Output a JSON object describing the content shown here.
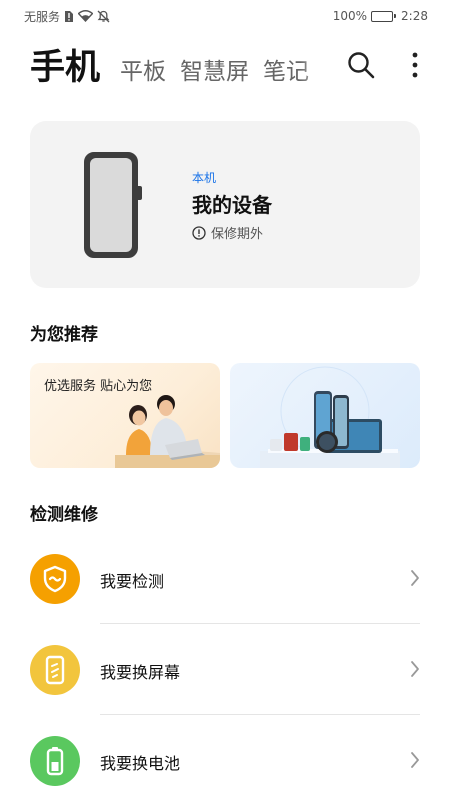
{
  "status_bar": {
    "carrier": "无服务",
    "battery": "100%",
    "time": "2:28"
  },
  "tabs": [
    {
      "label": "手机",
      "active": true
    },
    {
      "label": "平板",
      "active": false
    },
    {
      "label": "智慧屏",
      "active": false
    },
    {
      "label": "笔记",
      "active": false
    }
  ],
  "device": {
    "tag": "本机",
    "name": "我的设备",
    "warranty": "保修期外"
  },
  "recommend": {
    "title": "为您推荐",
    "cards": [
      {
        "label": "优选服务 贴心为您"
      },
      {
        "label": ""
      }
    ]
  },
  "repair": {
    "title": "检测维修",
    "items": [
      {
        "label": "我要检测",
        "icon": "shield-icon",
        "color": "#f5a000"
      },
      {
        "label": "我要换屏幕",
        "icon": "screen-icon",
        "color": "#f2c53d"
      },
      {
        "label": "我要换电池",
        "icon": "battery-icon",
        "color": "#5ac85f"
      }
    ]
  }
}
